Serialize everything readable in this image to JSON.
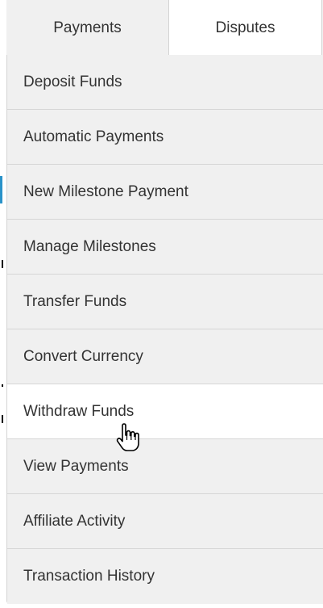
{
  "tabs": [
    {
      "label": "Payments"
    },
    {
      "label": "Disputes"
    }
  ],
  "menu": {
    "items": [
      {
        "label": "Deposit Funds"
      },
      {
        "label": "Automatic Payments"
      },
      {
        "label": "New Milestone Payment"
      },
      {
        "label": "Manage Milestones"
      },
      {
        "label": "Transfer Funds"
      },
      {
        "label": "Convert Currency"
      },
      {
        "label": "Withdraw Funds"
      },
      {
        "label": "View Payments"
      },
      {
        "label": "Affiliate Activity"
      },
      {
        "label": "Transaction History"
      }
    ],
    "hovered_item": "Withdraw Funds"
  },
  "colors": {
    "menu_background": "#f0f0f0",
    "hover_background": "#ffffff",
    "text": "#333333",
    "accent": "#2a93c9"
  },
  "cursor": {
    "icon": "hand-pointer-icon"
  }
}
